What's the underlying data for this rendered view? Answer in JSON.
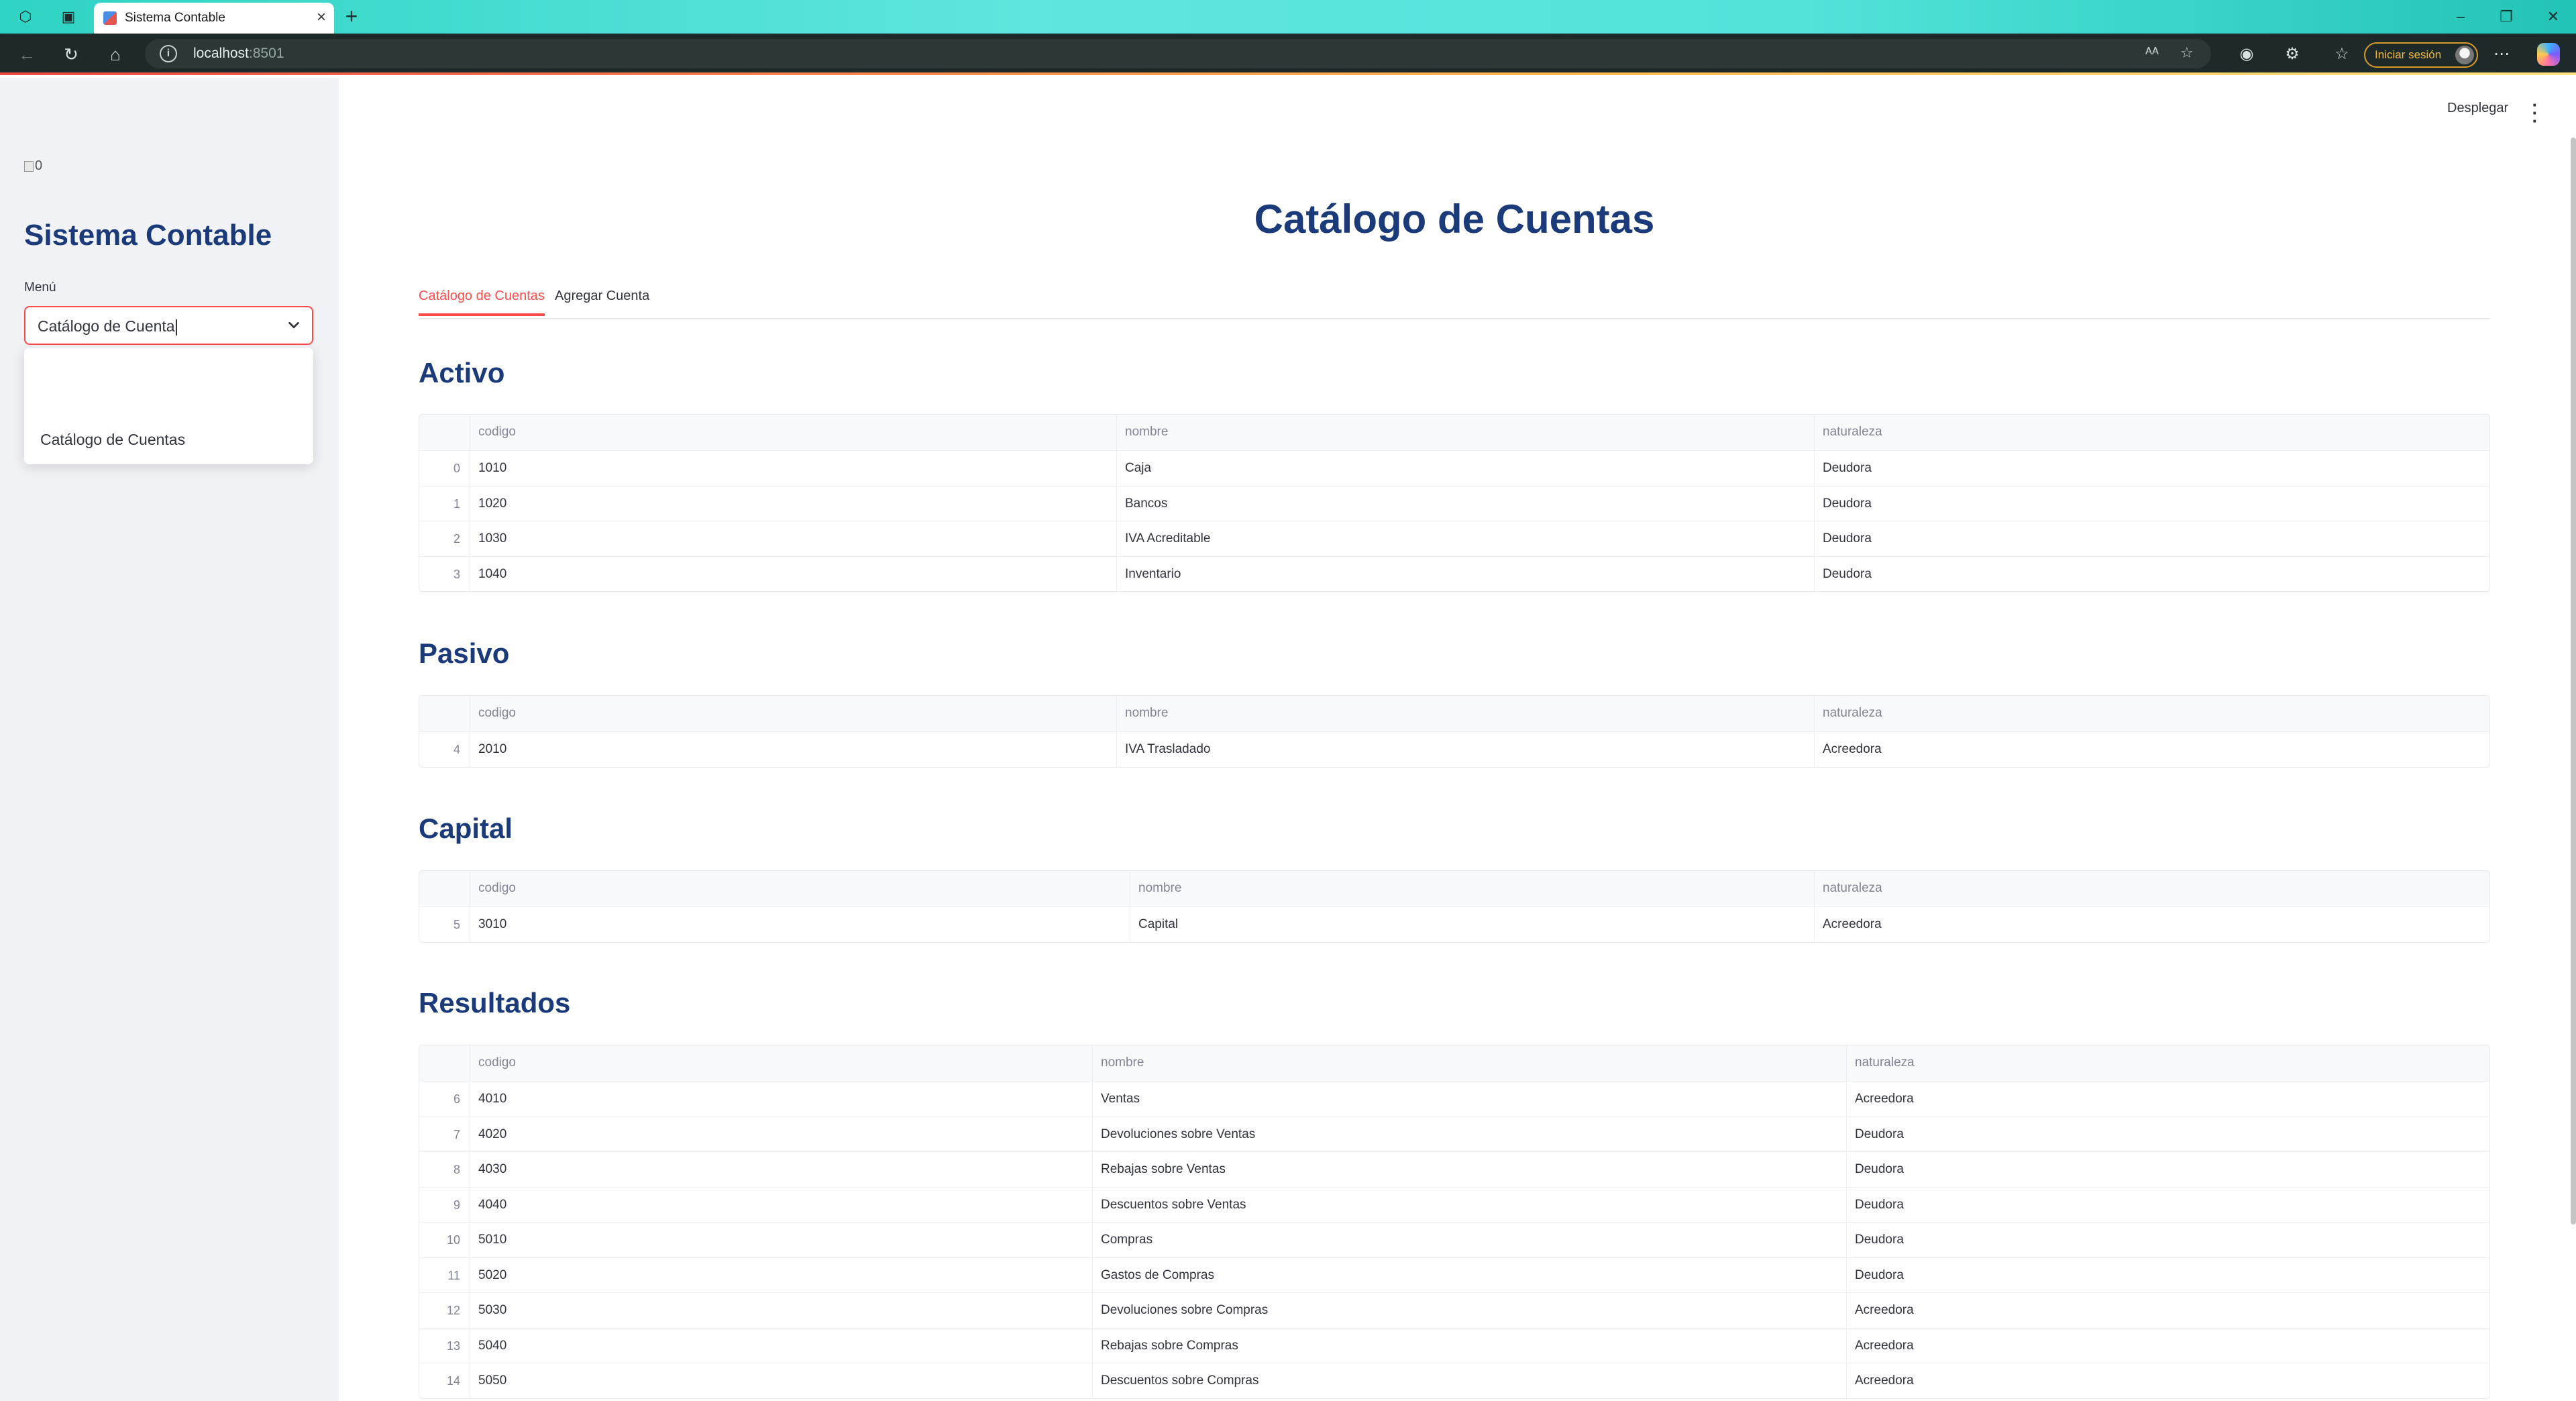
{
  "browser": {
    "tab_title": "Sistema Contable",
    "new_tab_symbol": "+",
    "url_host": "localhost",
    "url_port": ":8501",
    "signin_label": "Iniciar sesión"
  },
  "sidebar": {
    "image_alt": "0",
    "title": "Sistema Contable",
    "menu_label": "Menú",
    "select_value": "Catálogo de Cuenta",
    "options": [
      "Catálogo de Cuentas"
    ]
  },
  "header": {
    "deploy_label": "Desplegar"
  },
  "main": {
    "title": "Catálogo de Cuentas",
    "tabs": [
      {
        "label": "Catálogo de Cuentas",
        "active": true
      },
      {
        "label": "Agregar Cuenta",
        "active": false
      }
    ],
    "columns": [
      "codigo",
      "nombre",
      "naturaleza"
    ],
    "sections": [
      {
        "heading": "Activo",
        "rows": [
          {
            "index": "0",
            "codigo": "1010",
            "nombre": "Caja",
            "naturaleza": "Deudora"
          },
          {
            "index": "1",
            "codigo": "1020",
            "nombre": "Bancos",
            "naturaleza": "Deudora"
          },
          {
            "index": "2",
            "codigo": "1030",
            "nombre": "IVA Acreditable",
            "naturaleza": "Deudora"
          },
          {
            "index": "3",
            "codigo": "1040",
            "nombre": "Inventario",
            "naturaleza": "Deudora"
          }
        ]
      },
      {
        "heading": "Pasivo",
        "rows": [
          {
            "index": "4",
            "codigo": "2010",
            "nombre": "IVA Trasladado",
            "naturaleza": "Acreedora"
          }
        ]
      },
      {
        "heading": "Capital",
        "rows": [
          {
            "index": "5",
            "codigo": "3010",
            "nombre": "Capital",
            "naturaleza": "Acreedora"
          }
        ]
      },
      {
        "heading": "Resultados",
        "rows": [
          {
            "index": "6",
            "codigo": "4010",
            "nombre": "Ventas",
            "naturaleza": "Acreedora"
          },
          {
            "index": "7",
            "codigo": "4020",
            "nombre": "Devoluciones sobre Ventas",
            "naturaleza": "Deudora"
          },
          {
            "index": "8",
            "codigo": "4030",
            "nombre": "Rebajas sobre Ventas",
            "naturaleza": "Deudora"
          },
          {
            "index": "9",
            "codigo": "4040",
            "nombre": "Descuentos sobre Ventas",
            "naturaleza": "Deudora"
          },
          {
            "index": "10",
            "codigo": "5010",
            "nombre": "Compras",
            "naturaleza": "Deudora"
          },
          {
            "index": "11",
            "codigo": "5020",
            "nombre": "Gastos de Compras",
            "naturaleza": "Deudora"
          },
          {
            "index": "12",
            "codigo": "5030",
            "nombre": "Devoluciones sobre Compras",
            "naturaleza": "Acreedora"
          },
          {
            "index": "13",
            "codigo": "5040",
            "nombre": "Rebajas sobre Compras",
            "naturaleza": "Acreedora"
          },
          {
            "index": "14",
            "codigo": "5050",
            "nombre": "Descuentos sobre Compras",
            "naturaleza": "Acreedora"
          }
        ]
      }
    ]
  },
  "colors": {
    "accent": "#ff4b4b",
    "heading": "#1a3a7a",
    "sidebar_bg": "#f0f2f6"
  }
}
